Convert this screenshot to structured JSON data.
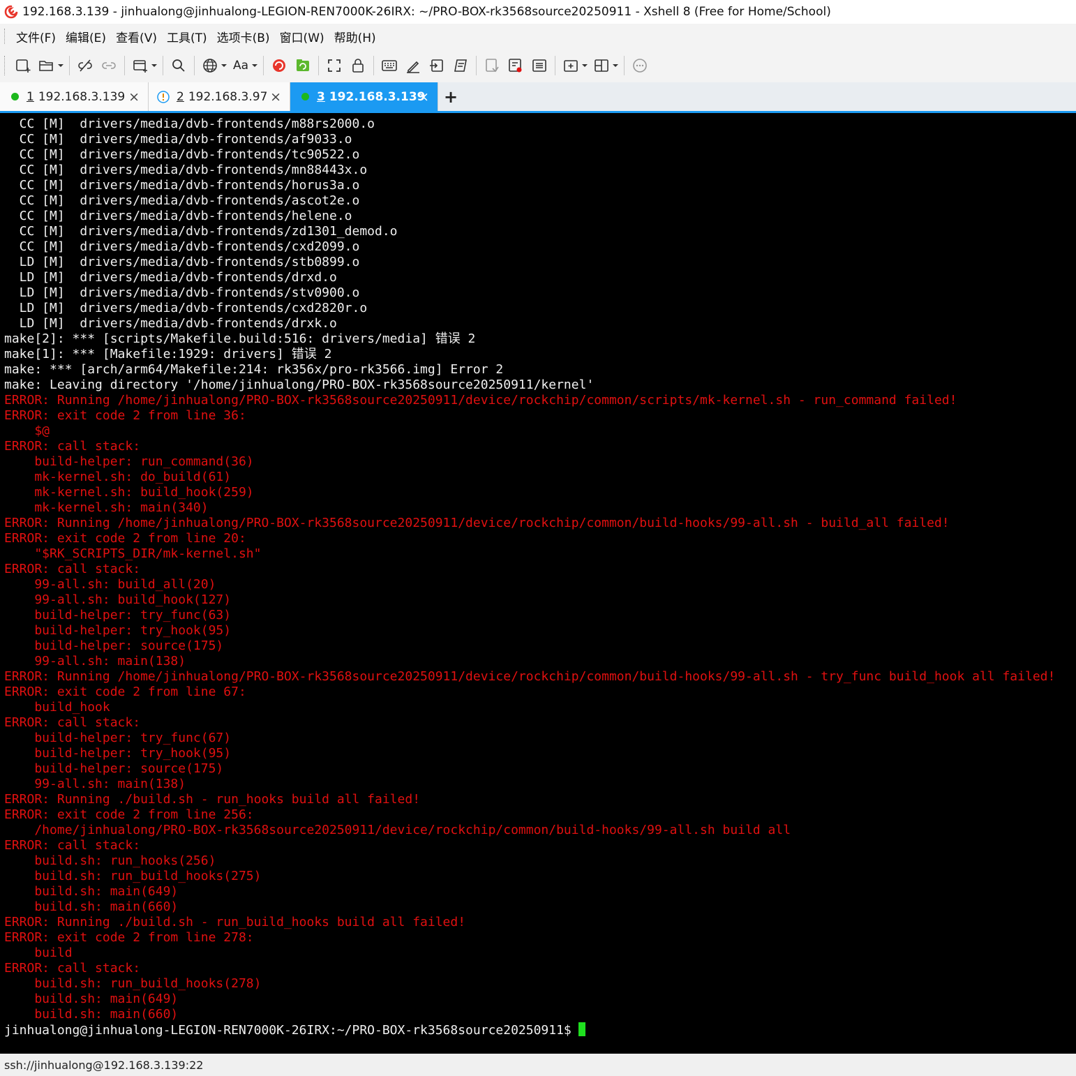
{
  "window": {
    "title": "192.168.3.139 - jinhualong@jinhualong-LEGION-REN7000K-26IRX: ~/PRO-BOX-rk3568source20250911 - Xshell 8 (Free for Home/School)",
    "app_icon": "xshell-logo-icon"
  },
  "menu": {
    "items": [
      "文件(F)",
      "编辑(E)",
      "查看(V)",
      "工具(T)",
      "选项卡(B)",
      "窗口(W)",
      "帮助(H)"
    ]
  },
  "toolbar": {
    "font_label": "Aa",
    "icons": [
      "new-session-icon",
      "open-folder-icon",
      "disconnect-icon",
      "reconnect-icon",
      "new-window-icon",
      "search-icon",
      "globe-icon",
      "font-icon",
      "xshell-icon",
      "xftp-icon",
      "fullscreen-icon",
      "lock-icon",
      "keyboard-icon",
      "compose-icon",
      "transfer-icon",
      "script-icon",
      "log-icon",
      "record-icon",
      "notes-icon",
      "add-tab-icon",
      "layout-icon",
      "chat-icon"
    ]
  },
  "tabs": [
    {
      "num": "1",
      "label": "192.168.3.139",
      "status": "connected",
      "active": false
    },
    {
      "num": "2",
      "label": "192.168.3.97",
      "status": "warning",
      "active": false
    },
    {
      "num": "3",
      "label": "192.168.3.139",
      "status": "connected",
      "active": true
    }
  ],
  "tab_add_label": "+",
  "tab_close_label": "×",
  "terminal": {
    "lines": [
      {
        "text": "  CC [M]  drivers/media/dvb-frontends/m88rs2000.o",
        "color": "w"
      },
      {
        "text": "  CC [M]  drivers/media/dvb-frontends/af9033.o",
        "color": "w"
      },
      {
        "text": "  CC [M]  drivers/media/dvb-frontends/tc90522.o",
        "color": "w"
      },
      {
        "text": "  CC [M]  drivers/media/dvb-frontends/mn88443x.o",
        "color": "w"
      },
      {
        "text": "  CC [M]  drivers/media/dvb-frontends/horus3a.o",
        "color": "w"
      },
      {
        "text": "  CC [M]  drivers/media/dvb-frontends/ascot2e.o",
        "color": "w"
      },
      {
        "text": "  CC [M]  drivers/media/dvb-frontends/helene.o",
        "color": "w"
      },
      {
        "text": "  CC [M]  drivers/media/dvb-frontends/zd1301_demod.o",
        "color": "w"
      },
      {
        "text": "  CC [M]  drivers/media/dvb-frontends/cxd2099.o",
        "color": "w"
      },
      {
        "text": "  LD [M]  drivers/media/dvb-frontends/stb0899.o",
        "color": "w"
      },
      {
        "text": "  LD [M]  drivers/media/dvb-frontends/drxd.o",
        "color": "w"
      },
      {
        "text": "  LD [M]  drivers/media/dvb-frontends/stv0900.o",
        "color": "w"
      },
      {
        "text": "  LD [M]  drivers/media/dvb-frontends/cxd2820r.o",
        "color": "w"
      },
      {
        "text": "  LD [M]  drivers/media/dvb-frontends/drxk.o",
        "color": "w"
      },
      {
        "text": "make[2]: *** [scripts/Makefile.build:516: drivers/media] 错误 2",
        "color": "w"
      },
      {
        "text": "make[1]: *** [Makefile:1929: drivers] 错误 2",
        "color": "w"
      },
      {
        "text": "make: *** [arch/arm64/Makefile:214: rk356x/pro-rk3566.img] Error 2",
        "color": "w"
      },
      {
        "text": "make: Leaving directory '/home/jinhualong/PRO-BOX-rk3568source20250911/kernel'",
        "color": "w"
      },
      {
        "text": "ERROR: Running /home/jinhualong/PRO-BOX-rk3568source20250911/device/rockchip/common/scripts/mk-kernel.sh - run_command failed!",
        "color": "r"
      },
      {
        "text": "ERROR: exit code 2 from line 36:",
        "color": "r"
      },
      {
        "text": "    $@",
        "color": "r"
      },
      {
        "text": "ERROR: call stack:",
        "color": "r"
      },
      {
        "text": "    build-helper: run_command(36)",
        "color": "r"
      },
      {
        "text": "    mk-kernel.sh: do_build(61)",
        "color": "r"
      },
      {
        "text": "    mk-kernel.sh: build_hook(259)",
        "color": "r"
      },
      {
        "text": "    mk-kernel.sh: main(340)",
        "color": "r"
      },
      {
        "text": "ERROR: Running /home/jinhualong/PRO-BOX-rk3568source20250911/device/rockchip/common/build-hooks/99-all.sh - build_all failed!",
        "color": "r"
      },
      {
        "text": "ERROR: exit code 2 from line 20:",
        "color": "r"
      },
      {
        "text": "    \"$RK_SCRIPTS_DIR/mk-kernel.sh\"",
        "color": "r"
      },
      {
        "text": "ERROR: call stack:",
        "color": "r"
      },
      {
        "text": "    99-all.sh: build_all(20)",
        "color": "r"
      },
      {
        "text": "    99-all.sh: build_hook(127)",
        "color": "r"
      },
      {
        "text": "    build-helper: try_func(63)",
        "color": "r"
      },
      {
        "text": "    build-helper: try_hook(95)",
        "color": "r"
      },
      {
        "text": "    build-helper: source(175)",
        "color": "r"
      },
      {
        "text": "    99-all.sh: main(138)",
        "color": "r"
      },
      {
        "text": "ERROR: Running /home/jinhualong/PRO-BOX-rk3568source20250911/device/rockchip/common/build-hooks/99-all.sh - try_func build_hook all failed!",
        "color": "r"
      },
      {
        "text": "ERROR: exit code 2 from line 67:",
        "color": "r"
      },
      {
        "text": "    build_hook",
        "color": "r"
      },
      {
        "text": "ERROR: call stack:",
        "color": "r"
      },
      {
        "text": "    build-helper: try_func(67)",
        "color": "r"
      },
      {
        "text": "    build-helper: try_hook(95)",
        "color": "r"
      },
      {
        "text": "    build-helper: source(175)",
        "color": "r"
      },
      {
        "text": "    99-all.sh: main(138)",
        "color": "r"
      },
      {
        "text": "ERROR: Running ./build.sh - run_hooks build all failed!",
        "color": "r"
      },
      {
        "text": "ERROR: exit code 2 from line 256:",
        "color": "r"
      },
      {
        "text": "    /home/jinhualong/PRO-BOX-rk3568source20250911/device/rockchip/common/build-hooks/99-all.sh build all",
        "color": "r"
      },
      {
        "text": "ERROR: call stack:",
        "color": "r"
      },
      {
        "text": "    build.sh: run_hooks(256)",
        "color": "r"
      },
      {
        "text": "    build.sh: run_build_hooks(275)",
        "color": "r"
      },
      {
        "text": "    build.sh: main(649)",
        "color": "r"
      },
      {
        "text": "    build.sh: main(660)",
        "color": "r"
      },
      {
        "text": "ERROR: Running ./build.sh - run_build_hooks build all failed!",
        "color": "r"
      },
      {
        "text": "ERROR: exit code 2 from line 278:",
        "color": "r"
      },
      {
        "text": "    build",
        "color": "r"
      },
      {
        "text": "ERROR: call stack:",
        "color": "r"
      },
      {
        "text": "    build.sh: run_build_hooks(278)",
        "color": "r"
      },
      {
        "text": "    build.sh: main(649)",
        "color": "r"
      },
      {
        "text": "    build.sh: main(660)",
        "color": "r"
      }
    ],
    "prompt": "jinhualong@jinhualong-LEGION-REN7000K-26IRX:~/PRO-BOX-rk3568source20250911$",
    "colors": {
      "background": "#000000",
      "text": "#f0f0f0",
      "error": "#e01010",
      "cursor": "#1fe01f"
    }
  },
  "status": {
    "connection": "ssh://jinhualong@192.168.3.139:22"
  },
  "colors": {
    "accent": "#1b9af2",
    "connected": "#1db81d",
    "warning": "#1b9af2"
  }
}
